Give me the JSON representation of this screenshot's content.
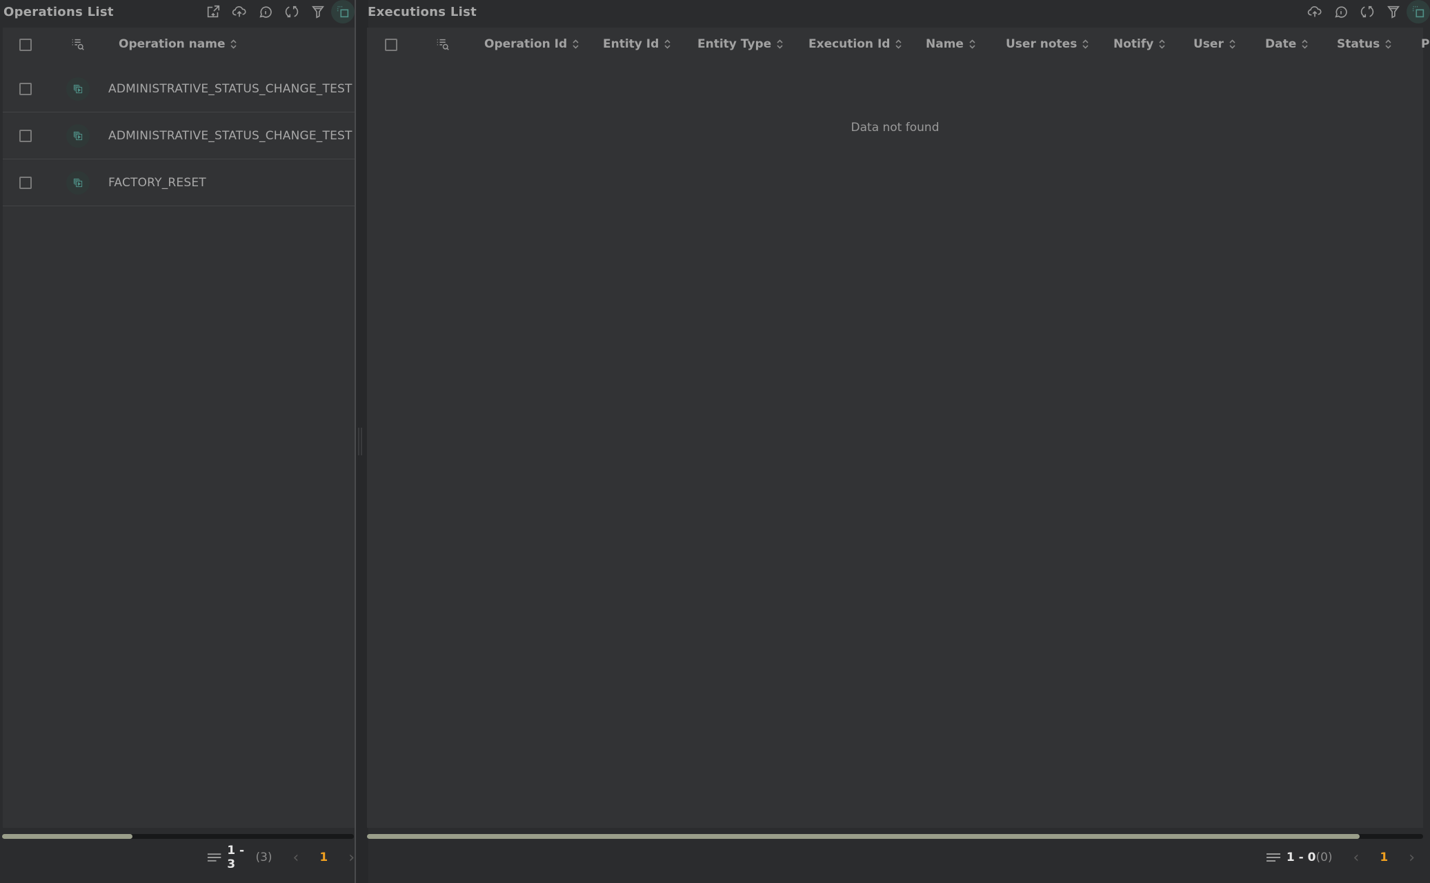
{
  "operations": {
    "title": "Operations List",
    "toolbar": [
      {
        "name": "export-icon",
        "label": "Export"
      },
      {
        "name": "upload-icon",
        "label": "Upload"
      },
      {
        "name": "info-icon",
        "label": "Info"
      },
      {
        "name": "refresh-icon",
        "label": "Refresh"
      },
      {
        "name": "filter-icon",
        "label": "Filter"
      },
      {
        "name": "selection-mode-icon",
        "label": "Selection mode",
        "active": true
      }
    ],
    "columns": [
      "Operation name"
    ],
    "rows": [
      {
        "name": "ADMINISTRATIVE_STATUS_CHANGE_TEST",
        "icon": "operation-type-icon"
      },
      {
        "name": "ADMINISTRATIVE_STATUS_CHANGE_TEST",
        "icon": "operation-type-icon"
      },
      {
        "name": "FACTORY_RESET",
        "icon": "operation-type-icon"
      }
    ],
    "scroll_fraction": 0.37,
    "pagination": {
      "range": "1 - 3",
      "total": "(3)",
      "current_page": "1"
    }
  },
  "executions": {
    "title": "Executions List",
    "toolbar": [
      {
        "name": "upload-icon",
        "label": "Upload"
      },
      {
        "name": "info-icon",
        "label": "Info"
      },
      {
        "name": "refresh-icon",
        "label": "Refresh"
      },
      {
        "name": "filter-icon",
        "label": "Filter"
      },
      {
        "name": "selection-mode-icon",
        "label": "Selection mode",
        "active": true
      }
    ],
    "columns": [
      "Operation Id",
      "Entity Id",
      "Entity Type",
      "Execution Id",
      "Name",
      "User notes",
      "Notify",
      "User",
      "Date",
      "Status",
      "P"
    ],
    "empty_message": "Data not found",
    "scroll_fraction": 0.94,
    "pagination": {
      "range": "1 - 0",
      "total": "(0)",
      "current_page": "1"
    }
  },
  "colors": {
    "accent": "#4f8f86",
    "page_current": "#f0a020",
    "scroll_thumb": "#9a9e8a"
  }
}
